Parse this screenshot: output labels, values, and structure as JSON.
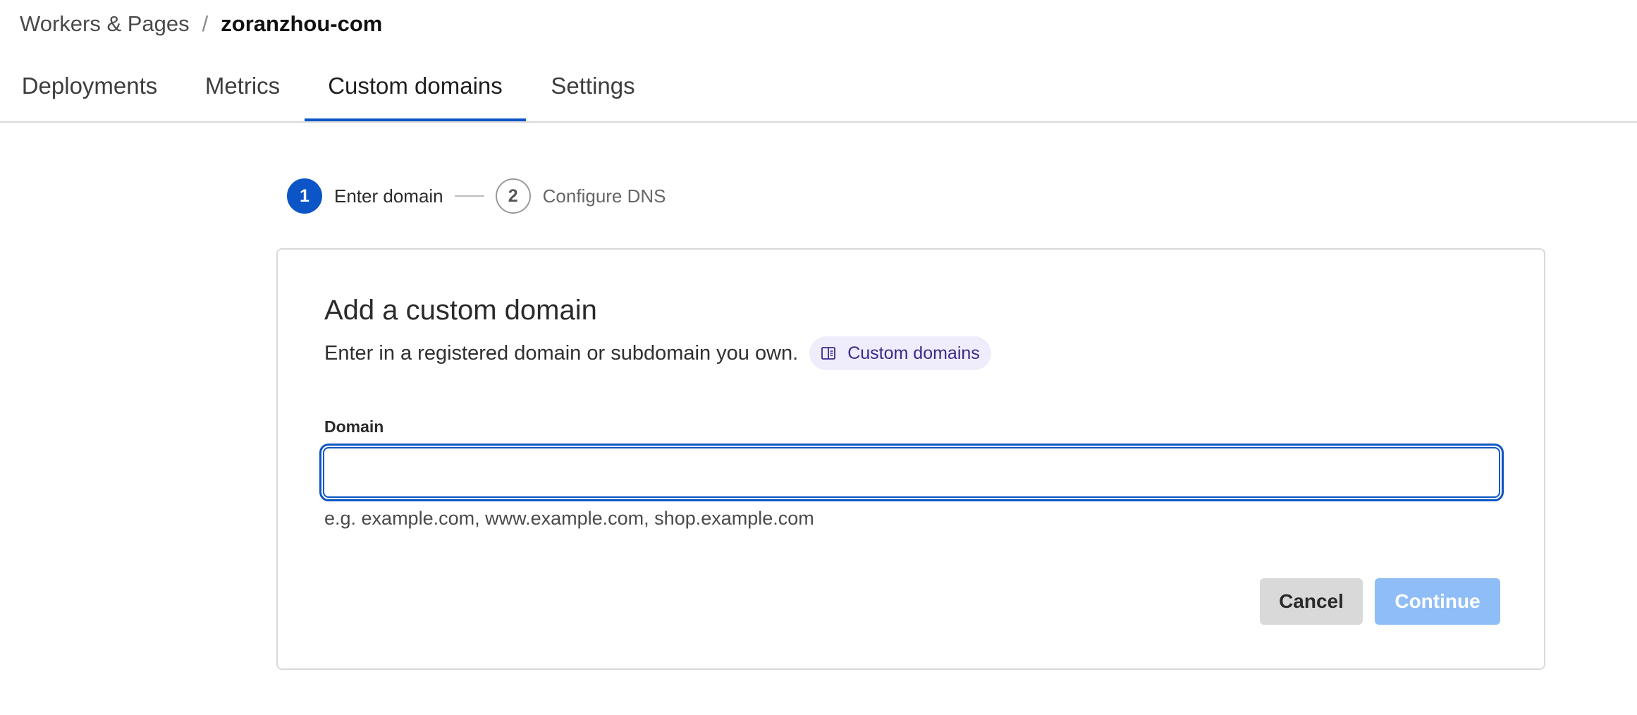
{
  "breadcrumb": {
    "parent": "Workers & Pages",
    "separator": "/",
    "current": "zoranzhou-com"
  },
  "tabs": [
    {
      "label": "Deployments",
      "active": false
    },
    {
      "label": "Metrics",
      "active": false
    },
    {
      "label": "Custom domains",
      "active": true
    },
    {
      "label": "Settings",
      "active": false
    }
  ],
  "stepper": {
    "steps": [
      {
        "number": "1",
        "label": "Enter domain",
        "state": "current"
      },
      {
        "number": "2",
        "label": "Configure DNS",
        "state": "upcoming"
      }
    ]
  },
  "card": {
    "title": "Add a custom domain",
    "description": "Enter in a registered domain or subdomain you own.",
    "doc_link": {
      "label": "Custom domains",
      "icon": "book-icon"
    },
    "field": {
      "label": "Domain",
      "value": "",
      "placeholder": "",
      "hint": "e.g. example.com, www.example.com, shop.example.com"
    },
    "buttons": {
      "cancel": "Cancel",
      "continue": "Continue"
    }
  },
  "colors": {
    "accent": "#0b55c6",
    "continue_disabled": "#8fbdf7",
    "cancel_bg": "#d9d9d9",
    "pill_bg": "#efedfb",
    "pill_text": "#3b2a8c"
  }
}
